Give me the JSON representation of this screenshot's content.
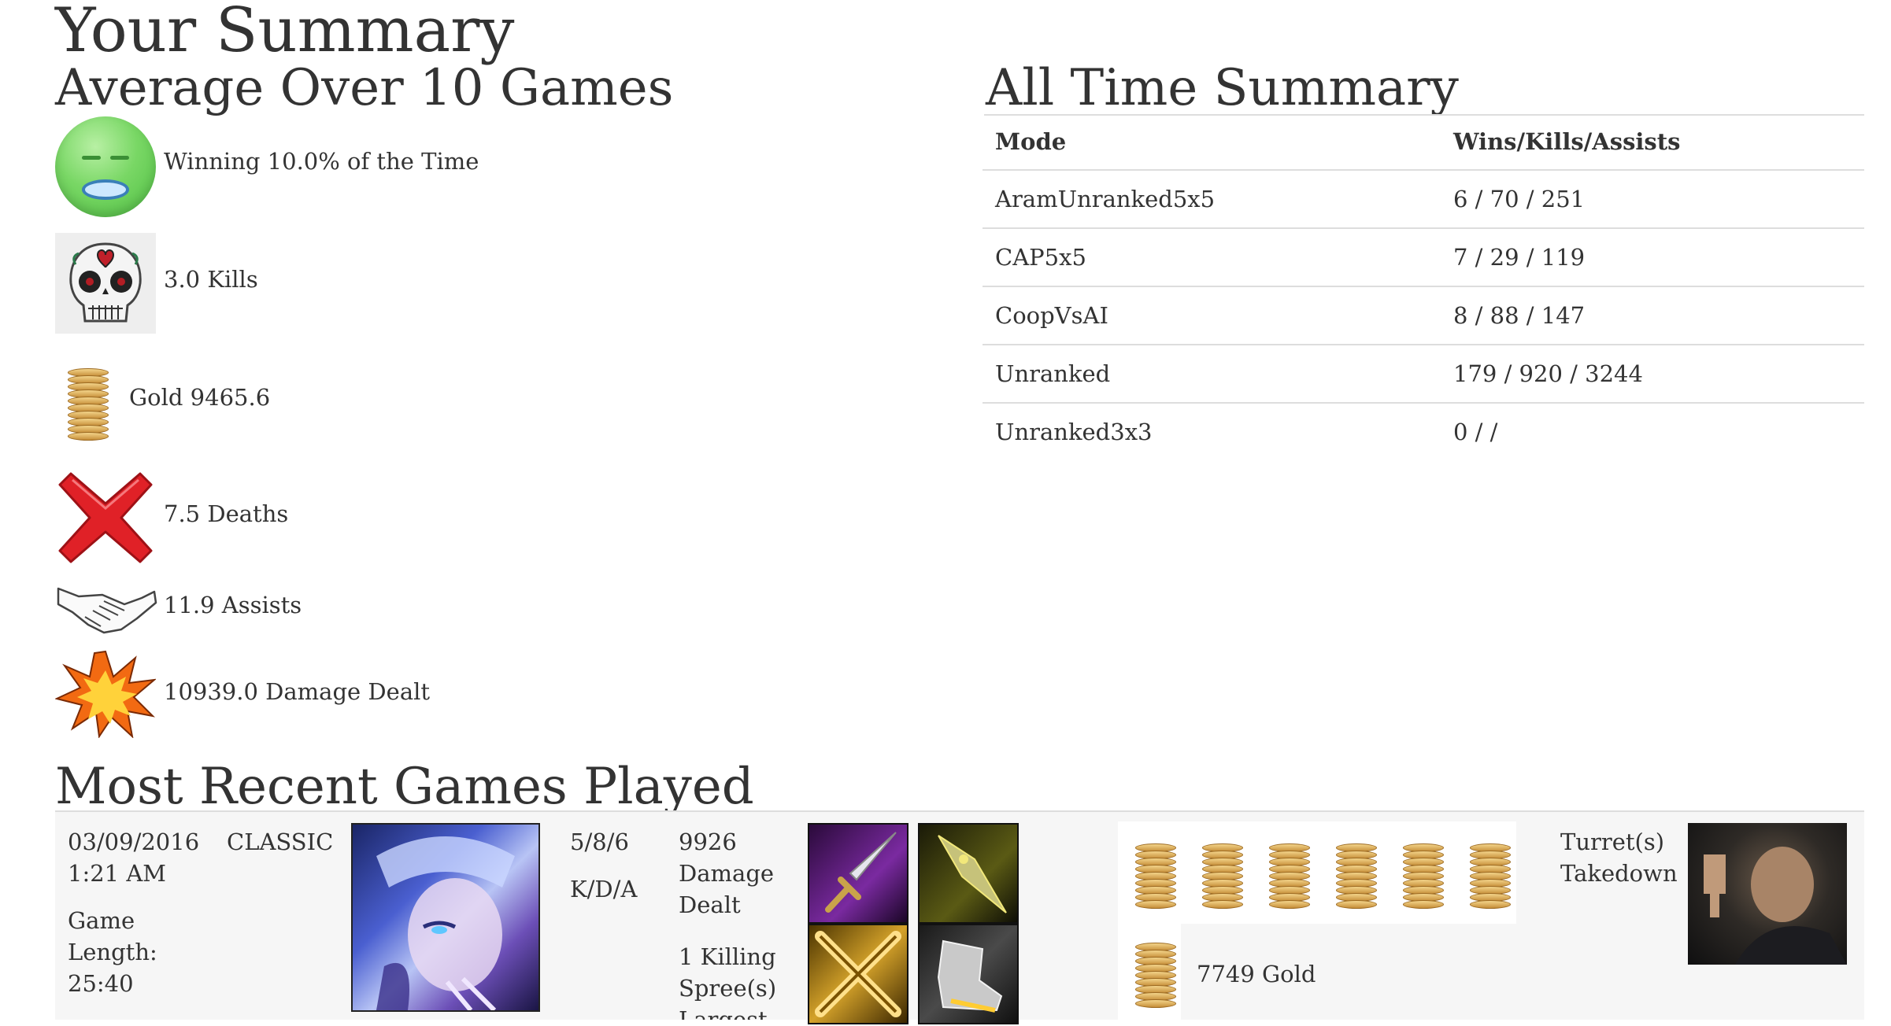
{
  "header": {
    "title": "Your Summary",
    "average_heading": "Average Over 10 Games",
    "all_time_heading": "All Time Summary",
    "recent_heading": "Most Recent Games Played"
  },
  "stats": {
    "winning": "Winning 10.0% of the Time",
    "kills": "3.0 Kills",
    "gold": "Gold 9465.6",
    "deaths": "7.5 Deaths",
    "assists": "11.9 Assists",
    "damage": "10939.0 Damage Dealt"
  },
  "all_time": {
    "columns": [
      "Mode",
      "Wins/Kills/Assists"
    ],
    "rows": [
      {
        "mode": "AramUnranked5x5",
        "wka": "6 / 70 / 251"
      },
      {
        "mode": "CAP5x5",
        "wka": "7 / 29 / 119"
      },
      {
        "mode": "CoopVsAI",
        "wka": "8 / 88 / 147"
      },
      {
        "mode": "Unranked",
        "wka": "179 / 920 / 3244"
      },
      {
        "mode": "Unranked3x3",
        "wka": "0 / /"
      }
    ]
  },
  "recent_game": {
    "date": "03/09/2016",
    "time": "1:21 AM",
    "mode": "CLASSIC",
    "length_label": "Game",
    "length_label2": "Length:",
    "length": "25:40",
    "kda": "5/8/6",
    "kda_label": "K/D/A",
    "damage_value": "9926",
    "damage_label1": "Damage",
    "damage_label2": "Dealt",
    "spree_line1": "1 Killing",
    "spree_line2": "Spree(s)",
    "largest_partial": "Largest",
    "gold": "7749 Gold",
    "turret_line1": "Turret(s)",
    "turret_line2": "Takedown"
  },
  "colors": {
    "text": "#333333",
    "rule": "#dddddd",
    "panel": "#f6f6f6",
    "face_green": "#79d765",
    "x_red": "#e02127"
  }
}
